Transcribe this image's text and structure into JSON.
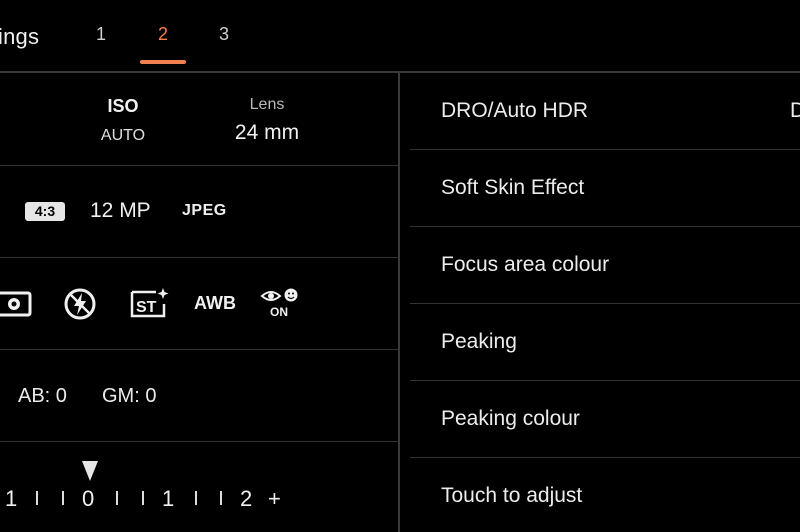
{
  "header": {
    "title": "ings",
    "tabs": [
      {
        "label": "1",
        "active": false
      },
      {
        "label": "2",
        "active": true
      },
      {
        "label": "3",
        "active": false
      }
    ],
    "accent_color": "#f07f52"
  },
  "left_panel": {
    "iso": {
      "label": "ISO",
      "value": "AUTO"
    },
    "lens": {
      "label": "Lens",
      "value": "24 mm"
    },
    "image": {
      "aspect": "4:3",
      "megapixels": "12 MP",
      "format": "JPEG"
    },
    "mode_icons": [
      "metering-icon",
      "flash-off-icon",
      "steady-shot-icon",
      "awb-label",
      "red-eye-reduction-icon"
    ],
    "awb": "AWB",
    "red_eye": "ON",
    "white_balance": {
      "ab": "AB: 0",
      "gm": "GM: 0"
    },
    "exposure_scale": {
      "labels": [
        "1",
        "0",
        "1",
        "2",
        "+"
      ],
      "current_value": "0"
    }
  },
  "settings": {
    "items": [
      {
        "label": "DRO/Auto HDR",
        "value": "D"
      },
      {
        "label": "Soft Skin Effect",
        "value": ""
      },
      {
        "label": "Focus area colour",
        "value": ""
      },
      {
        "label": "Peaking",
        "value": ""
      },
      {
        "label": "Peaking colour",
        "value": ""
      },
      {
        "label": "Touch to adjust",
        "value": ""
      }
    ]
  }
}
